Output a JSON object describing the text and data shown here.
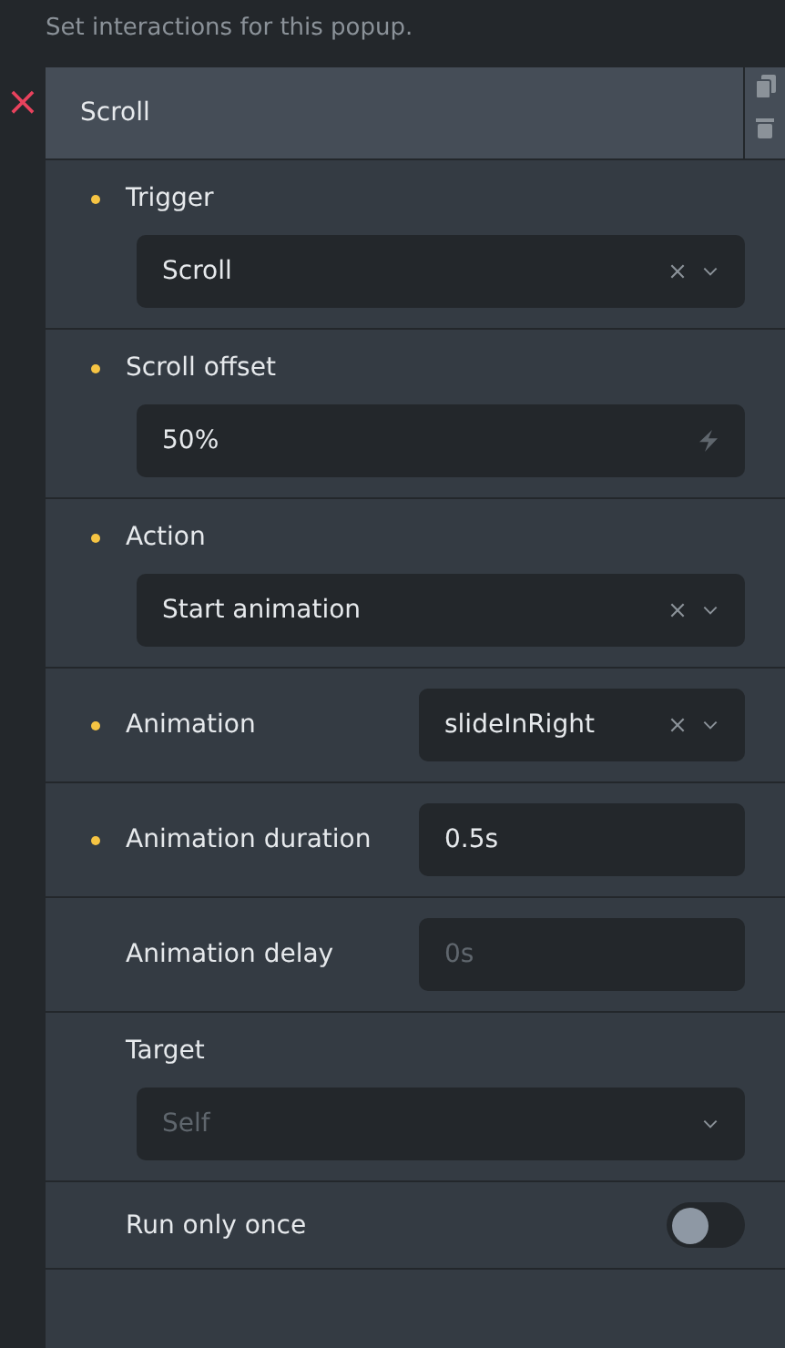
{
  "description": "Set interactions for this popup.",
  "interaction": {
    "title": "Scroll",
    "remove_label": "×"
  },
  "settings": [
    {
      "kind": "select",
      "inline": false,
      "label": "Trigger",
      "required": true,
      "value": "Scroll",
      "clearable": true
    },
    {
      "kind": "input",
      "inline": false,
      "label": "Scroll offset",
      "required": true,
      "value": "50%",
      "dynamic": true
    },
    {
      "kind": "select",
      "inline": false,
      "label": "Action",
      "required": true,
      "value": "Start animation",
      "clearable": true
    },
    {
      "kind": "select",
      "inline": true,
      "label": "Animation",
      "required": true,
      "value": "slideInRight",
      "clearable": true
    },
    {
      "kind": "input",
      "inline": true,
      "label": "Animation duration",
      "required": true,
      "value": "0.5s",
      "dynamic": false
    },
    {
      "kind": "input",
      "inline": true,
      "label": "Animation delay",
      "required": false,
      "placeholder": "0s",
      "dynamic": false
    },
    {
      "kind": "select",
      "inline": false,
      "label": "Target",
      "required": false,
      "placeholder": "Self",
      "clearable": false
    },
    {
      "kind": "toggle",
      "inline": true,
      "label": "Run only once",
      "required": false,
      "on": false
    }
  ]
}
